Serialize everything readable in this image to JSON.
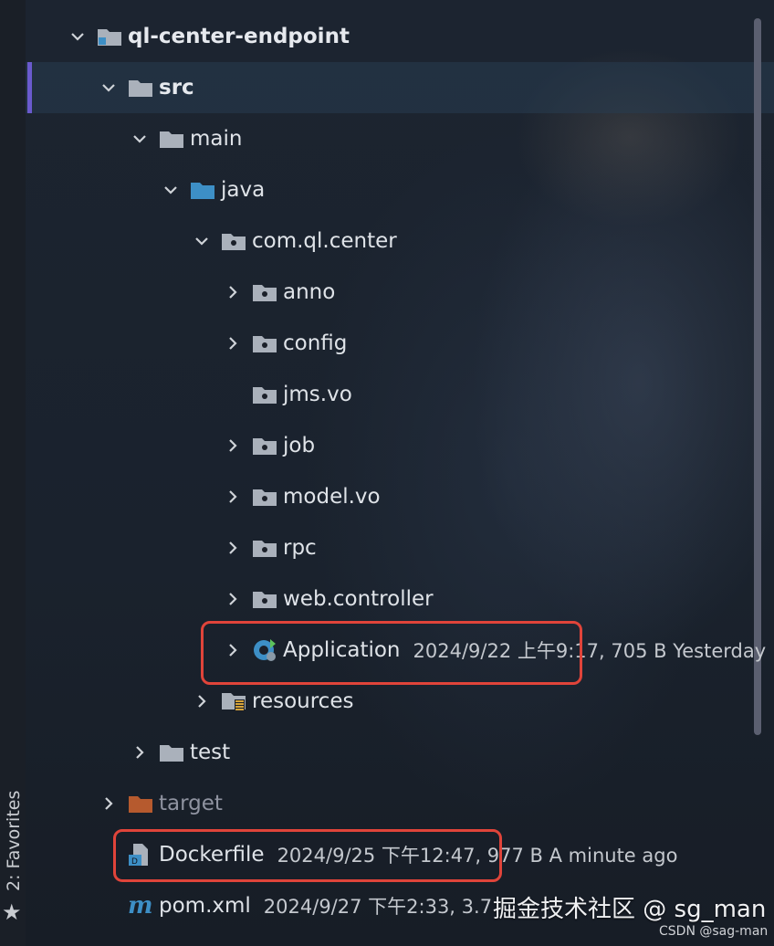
{
  "sidebar": {
    "favorites_label": "2: Favorites"
  },
  "tree": [
    {
      "label": "ql-center-endpoint",
      "arrow": "down",
      "icon": "module-folder",
      "indent": 0
    },
    {
      "label": "src",
      "arrow": "down",
      "icon": "folder",
      "indent": 1
    },
    {
      "label": "main",
      "arrow": "down",
      "icon": "folder",
      "indent": 2
    },
    {
      "label": "java",
      "arrow": "down",
      "icon": "source-folder",
      "indent": 3
    },
    {
      "label": "com.ql.center",
      "arrow": "down",
      "icon": "package",
      "indent": 4
    },
    {
      "label": "anno",
      "arrow": "right",
      "icon": "package",
      "indent": 5
    },
    {
      "label": "config",
      "arrow": "right",
      "icon": "package",
      "indent": 5
    },
    {
      "label": "jms.vo",
      "arrow": "none",
      "icon": "package",
      "indent": 5
    },
    {
      "label": "job",
      "arrow": "right",
      "icon": "package",
      "indent": 5
    },
    {
      "label": "model.vo",
      "arrow": "right",
      "icon": "package",
      "indent": 5
    },
    {
      "label": "rpc",
      "arrow": "right",
      "icon": "package",
      "indent": 5
    },
    {
      "label": "web.controller",
      "arrow": "right",
      "icon": "package",
      "indent": 5
    },
    {
      "label": "Application",
      "arrow": "right",
      "icon": "spring-boot-class",
      "indent": 5,
      "meta": "2024/9/22 上午9:17, 705 B Yesterday"
    },
    {
      "label": "resources",
      "arrow": "right",
      "icon": "resources-folder",
      "indent": 4
    },
    {
      "label": "test",
      "arrow": "right",
      "icon": "folder",
      "indent": 2
    },
    {
      "label": "target",
      "arrow": "right",
      "icon": "excluded-folder",
      "indent": 1
    },
    {
      "label": "Dockerfile",
      "arrow": "none",
      "icon": "dockerfile",
      "indent": 1,
      "meta": "2024/9/25 下午12:47, 977 B A minute ago"
    },
    {
      "label": "pom.xml",
      "arrow": "none",
      "icon": "maven",
      "indent": 1,
      "meta": "2024/9/27 下午2:33, 3.7"
    }
  ],
  "watermark": "掘金技术社区 @ sg_man",
  "csdn_mark": "CSDN @sag-man",
  "colors": {
    "highlight": "#e0443a",
    "accent": "#6a5acd",
    "folder": "#aab1bb",
    "source_folder": "#3d8fc6",
    "excluded_folder": "#b65a2e"
  }
}
